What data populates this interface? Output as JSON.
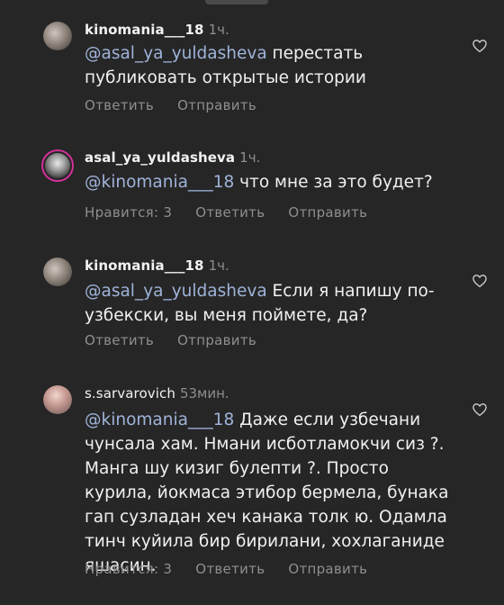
{
  "comments": [
    {
      "username": "kinomania___18",
      "time": "1ч.",
      "mention": "@asal_ya_yuldasheva",
      "text": " перестать публиковать открытые истории",
      "likes_label": "",
      "reply_label": "Ответить",
      "send_label": "Отправить"
    },
    {
      "username": "asal_ya_yuldasheva",
      "time": "1ч.",
      "mention": "@kinomania___18",
      "text": " что мне за это будет?",
      "likes_label": "Нравится: 3",
      "reply_label": "Ответить",
      "send_label": "Отправить"
    },
    {
      "username": "kinomania___18",
      "time": "1ч.",
      "mention": "@asal_ya_yuldasheva",
      "text": " Если я напишу по-узбекски, вы меня поймете, да?",
      "likes_label": "",
      "reply_label": "Ответить",
      "send_label": "Отправить"
    },
    {
      "username": "s.sarvarovich",
      "time": "53мин.",
      "mention": "@kinomania___18",
      "text": " Даже если узбечани чунсала хам. Нмани исботламокчи сиз ?. Манга шу кизиг булепти ?. Просто курила, йокмаса этибор бермела, бунака гап сузладан хеч канака толк ю.  Одамла тинч куйила бир бирилани, хохлаганиде яшасин.",
      "likes_label": "Нравится: 3",
      "reply_label": "Ответить",
      "send_label": "Отправить"
    }
  ]
}
